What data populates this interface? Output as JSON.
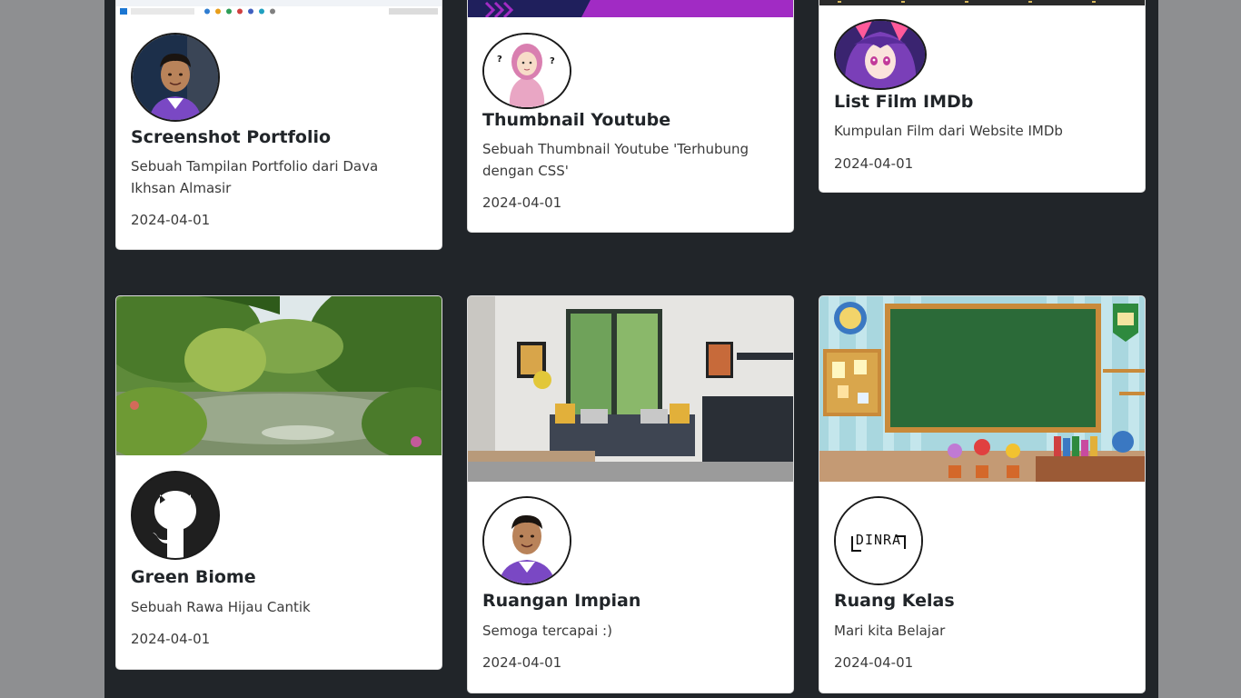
{
  "cards": [
    {
      "title": "Screenshot Portfolio",
      "description": "Sebuah Tampilan Portfolio dari Dava Ikhsan Almasir",
      "date": "2024-04-01",
      "banner_icon": "desktop-screenshot-image",
      "avatar_icon": "person-photo-avatar"
    },
    {
      "title": "Thumbnail Youtube",
      "description": "Sebuah Thumbnail Youtube 'Terhubung dengan CSS'",
      "date": "2024-04-01",
      "banner_icon": "purple-thumbnail-image",
      "avatar_icon": "hijab-girl-illustration-avatar"
    },
    {
      "title": "List Film IMDb",
      "description": "Kumpulan Film dari Website IMDb",
      "date": "2024-04-01",
      "banner_icon": "film-strip-image",
      "avatar_icon": "anime-girl-avatar"
    },
    {
      "title": "Green Biome",
      "description": "Sebuah Rawa Hijau Cantik",
      "date": "2024-04-01",
      "banner_icon": "green-pond-garden-image",
      "avatar_icon": "github-icon"
    },
    {
      "title": "Ruangan Impian",
      "description": "Semoga tercapai :)",
      "date": "2024-04-01",
      "banner_icon": "modern-kitchen-room-image",
      "avatar_icon": "person-photo-avatar"
    },
    {
      "title": "Ruang Kelas",
      "description": "Mari kita Belajar",
      "date": "2024-04-01",
      "banner_icon": "classroom-chalkboard-image",
      "avatar_icon": "dinra-logo-icon",
      "avatar_logo_text": "DINRA"
    }
  ],
  "colors": {
    "page_bg": "#212529",
    "outer_bg": "#8e8f91",
    "card_bg": "#ffffff",
    "text_dark": "#212529"
  }
}
